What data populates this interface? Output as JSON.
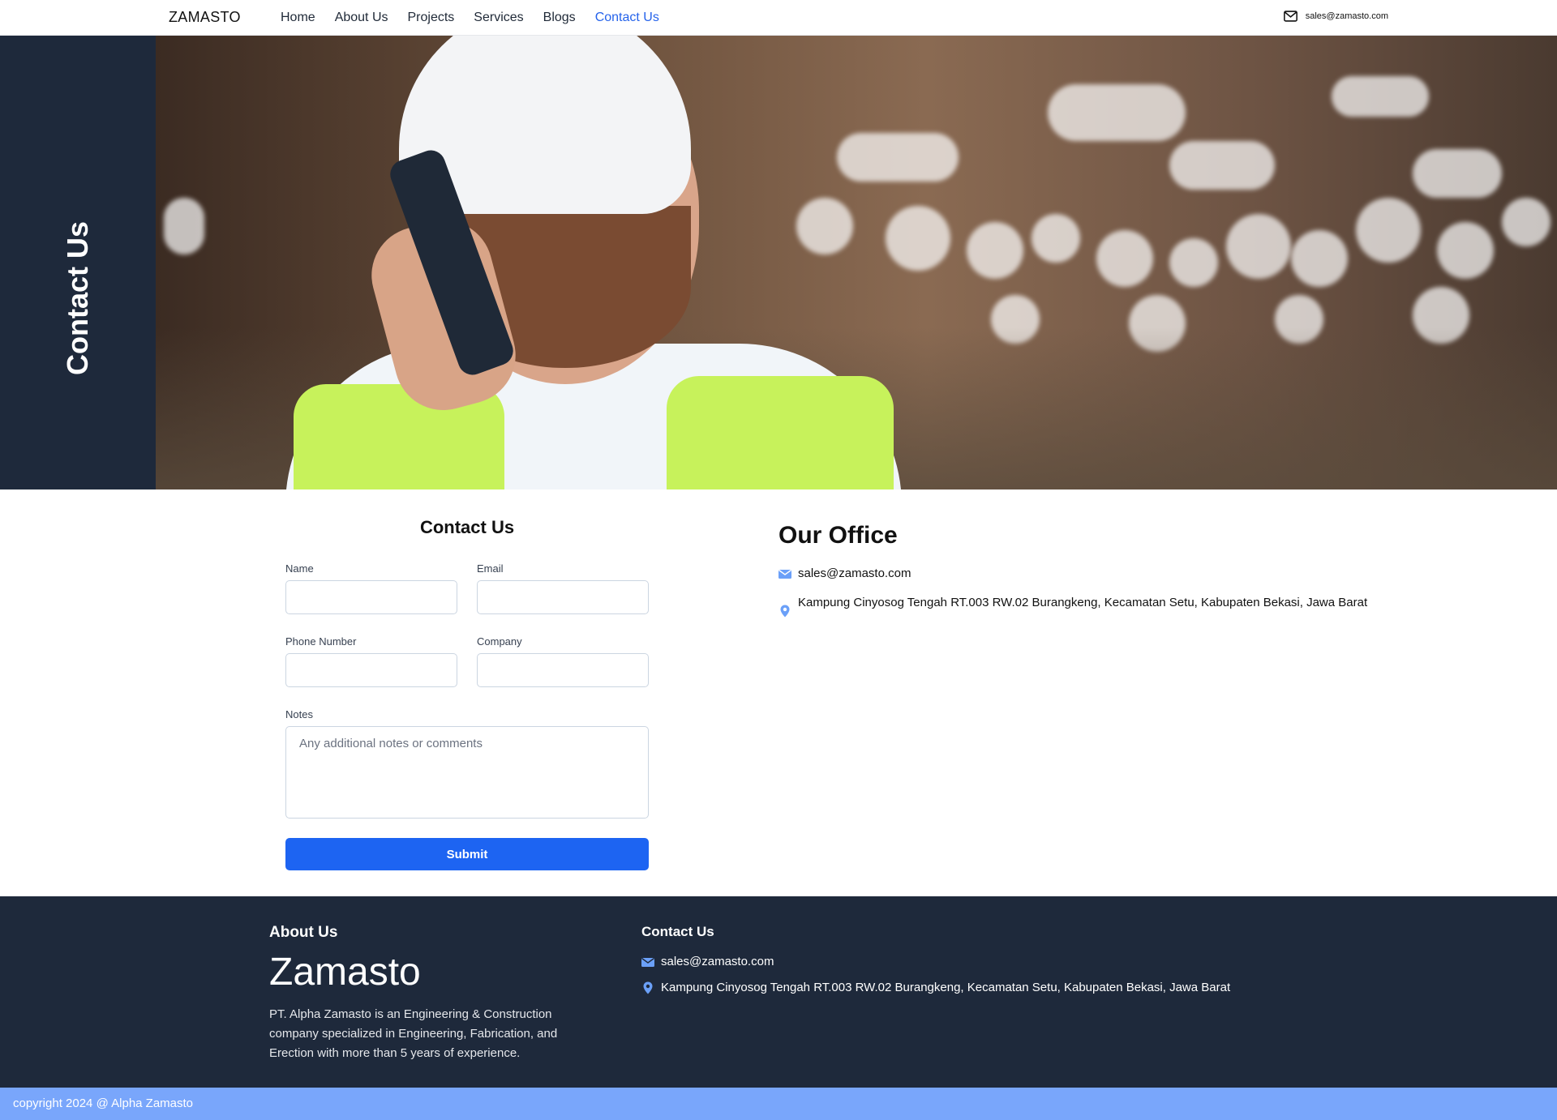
{
  "nav": {
    "brand": "ZAMASTO",
    "links": [
      "Home",
      "About Us",
      "Projects",
      "Services",
      "Blogs",
      "Contact Us"
    ],
    "active": "Contact Us",
    "email": "sales@zamasto.com"
  },
  "hero": {
    "title": "Contact Us"
  },
  "form": {
    "title": "Contact Us",
    "name_label": "Name",
    "email_label": "Email",
    "phone_label": "Phone Number",
    "company_label": "Company",
    "notes_label": "Notes",
    "name_value": "",
    "email_value": "",
    "phone_value": "",
    "company_value": "",
    "notes_placeholder": "Any additional notes or comments",
    "submit_label": "Submit"
  },
  "office": {
    "title": "Our Office",
    "email": "sales@zamasto.com",
    "address": "Kampung Cinyosog Tengah RT.003 RW.02 Burangkeng, Kecamatan Setu, Kabupaten Bekasi, Jawa Barat"
  },
  "footer": {
    "about_heading": "About Us",
    "brand": "Zamasto",
    "description": "PT. Alpha Zamasto is an Engineering & Construction company specialized in Engineering, Fabrication, and Erection with more than 5 years of experience.",
    "contact_heading": "Contact Us",
    "email": "sales@zamasto.com",
    "address": "Kampung Cinyosog Tengah RT.003 RW.02 Burangkeng, Kecamatan Setu, Kabupaten Bekasi, Jawa Barat"
  },
  "copyright": "copyright 2024 @ Alpha Zamasto",
  "icons": {
    "nav_mail": "mail-outline-icon",
    "office_mail": "envelope-icon",
    "office_location": "map-pin-icon"
  },
  "colors": {
    "primary": "#1d64f2",
    "nav_active": "#2563eb",
    "dark_navy": "#1e293b",
    "copyright_bar": "#79a6fb",
    "icon_blue": "#6ba0f8"
  }
}
